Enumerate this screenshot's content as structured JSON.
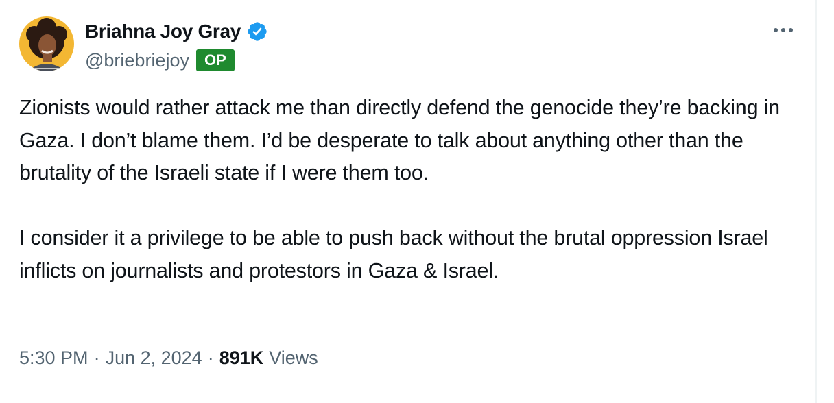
{
  "author": {
    "display_name": "Briahna Joy Gray",
    "handle": "@briebriejoy",
    "badge": "OP",
    "verified_icon": "verified-badge-icon"
  },
  "more_icon": "more-horizontal-icon",
  "tweet": {
    "paragraphs": [
      "Zionists would rather attack me than directly defend the genocide they’re backing in Gaza. I don’t blame them. I’d be desperate to talk about anything other than the brutality of the Israeli state if I were them too.",
      "I consider it a privilege to be able to push back without the brutal oppression Israel inflicts on journalists and protestors in Gaza & Israel."
    ]
  },
  "meta": {
    "time": "5:30 PM",
    "separator": "·",
    "date": "Jun 2, 2024",
    "views_count": "891K",
    "views_label": "Views"
  },
  "colors": {
    "verified": "#1d9bf0",
    "op_badge": "#1f8a2f",
    "secondary_text": "#536471",
    "primary_text": "#0f1419"
  }
}
